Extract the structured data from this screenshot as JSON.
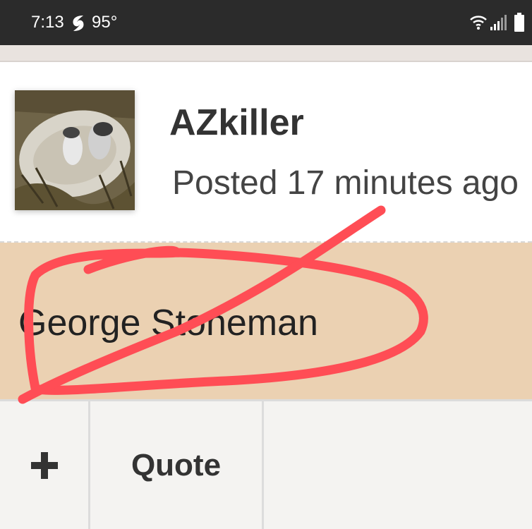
{
  "status_bar": {
    "time": "7:13",
    "weather_icon": "hurricane-icon",
    "temperature": "95°",
    "wifi_icon": "wifi-icon",
    "signal_icon": "signal-icon",
    "battery_icon": "battery-icon"
  },
  "post": {
    "author": "AZkiller",
    "posted": "Posted 17 minutes ago",
    "content": "George Stoneman"
  },
  "footer": {
    "plus_icon": "plus-icon",
    "quote_label": "Quote"
  },
  "colors": {
    "status_bar_bg": "#2b2b2b",
    "post_body_bg": "#ebd1b2",
    "annotation_red": "#ff4d55"
  }
}
